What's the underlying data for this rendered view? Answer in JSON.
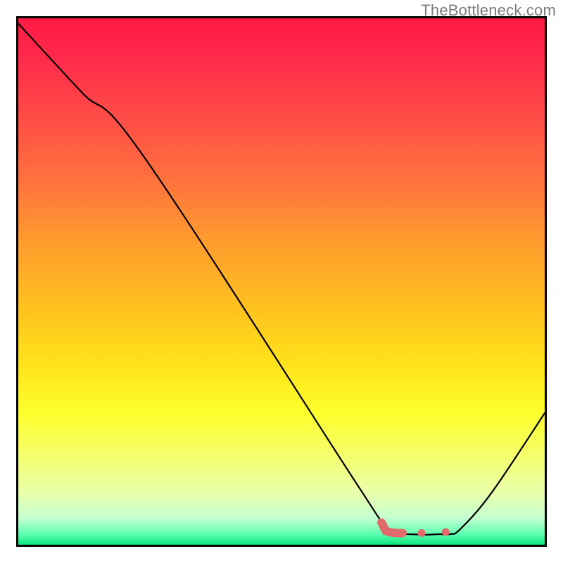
{
  "watermark": "TheBottleneck.com",
  "colors": {
    "line_main": "#000000",
    "line_accent": "#e26a6a",
    "frame": "#000000"
  },
  "chart_data": {
    "type": "line",
    "title": "",
    "xlabel": "",
    "ylabel": "",
    "xlim": [
      0,
      100
    ],
    "ylim": [
      0,
      100
    ],
    "series": [
      {
        "name": "curve",
        "x": [
          0,
          12,
          24,
          64,
          70,
          72,
          74,
          77.5,
          80,
          82,
          84,
          90,
          100
        ],
        "y": [
          99,
          86,
          73.5,
          12,
          3,
          2,
          2,
          1.9,
          2,
          2,
          3,
          10,
          25
        ]
      }
    ],
    "accent_segment": {
      "name": "optimal-range",
      "x": [
        69.0,
        69.8,
        71.0,
        72.0,
        73.0,
        74.5,
        76.6,
        77.5,
        79.6,
        81.2
      ],
      "y": [
        4.2,
        2.6,
        2.3,
        2.2,
        2.2,
        2.2,
        2.2,
        2.1,
        2.1,
        2.4
      ],
      "on": [
        1,
        1,
        1,
        1,
        1,
        0,
        1,
        0,
        0,
        1
      ]
    }
  }
}
